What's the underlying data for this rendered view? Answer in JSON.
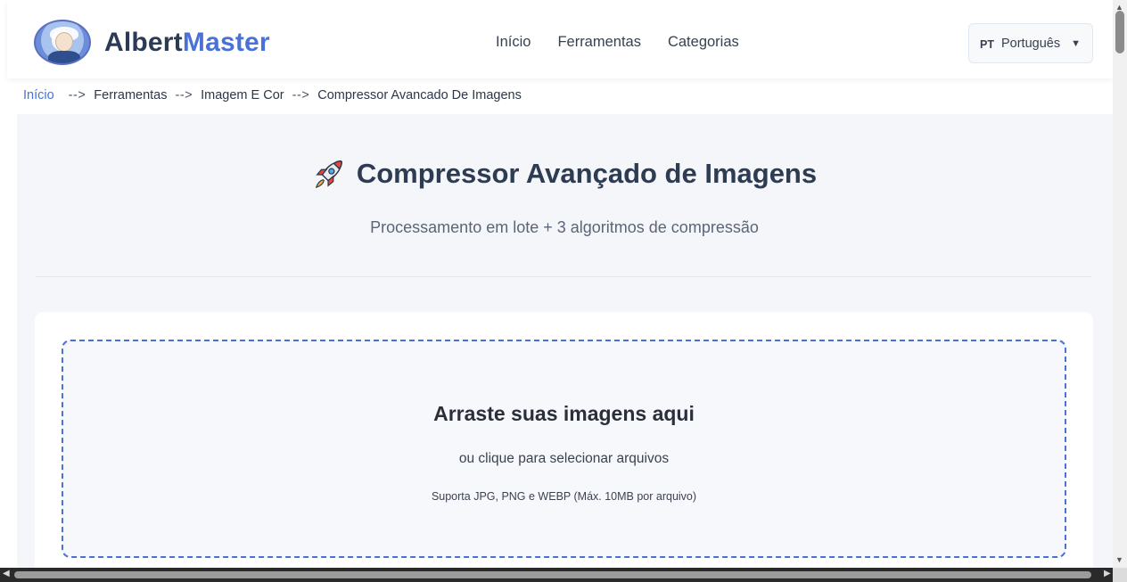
{
  "header": {
    "logo_part1": "Albert",
    "logo_part2": "Master",
    "nav": [
      "Início",
      "Ferramentas",
      "Categorias"
    ],
    "lang_code": "PT",
    "lang_label": "Português",
    "lang_arrow": "▼"
  },
  "breadcrumb": {
    "items": [
      "Início",
      "Ferramentas",
      "Imagem E Cor",
      "Compressor Avancado De Imagens"
    ],
    "separator": "-->"
  },
  "hero": {
    "icon": "rocket-icon",
    "title": "Compressor Avançado de Imagens",
    "subtitle": "Processamento em lote + 3 algoritmos de compressão"
  },
  "dropzone": {
    "title": "Arraste suas imagens aqui",
    "subtitle": "ou clique para selecionar arquivos",
    "note": "Suporta JPG, PNG e WEBP (Máx. 10MB por arquivo)"
  },
  "colors": {
    "accent": "#4a72d6",
    "logo_dark": "#2b3a55",
    "page_bg": "#f5f6fa"
  }
}
